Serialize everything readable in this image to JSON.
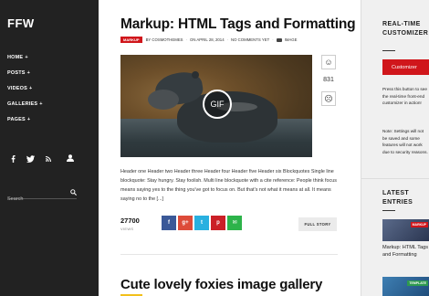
{
  "sidebar": {
    "logo": "FFW",
    "nav": [
      {
        "label": "HOME",
        "plus": "+"
      },
      {
        "label": "POSTS",
        "plus": "+"
      },
      {
        "label": "VIDEOS",
        "plus": "+"
      },
      {
        "label": "GALLERIES",
        "plus": "+"
      },
      {
        "label": "PAGES",
        "plus": "+"
      }
    ],
    "social_icons": [
      "facebook-icon",
      "twitter-icon",
      "rss-icon",
      "user-icon"
    ],
    "search": {
      "placeholder": "Search"
    }
  },
  "post": {
    "title": "Markup: HTML Tags and Formatting",
    "category": "MARKUP",
    "author": "BY COSMOTHEMES",
    "date": "ON APRIL 28, 2014",
    "comments": "NO COMMENTS YET",
    "format": "IMAGE",
    "image_badge": "GIF",
    "vote_count": "831",
    "excerpt": "Header one Header two Header three Header four Header five Header six Blockquotes Single line blockquote: Stay hungry. Stay foolish. Multi line blockquote with a cite reference: People think focus means saying yes to the thing you've got to focus on. But that's not what it means at all. It means saying no to the [...]",
    "views_count": "27700",
    "views_label": "VIEWS",
    "share": {
      "fb": "f",
      "gp": "g+",
      "tw": "t",
      "pi": "p",
      "em": "✉"
    },
    "full_story": "FULL STORY"
  },
  "post2": {
    "title": "Cute lovely foxies image gallery"
  },
  "customizer": {
    "title_line1": "REAL-TIME",
    "title_line2": "CUSTOMIZER",
    "button": "Customizer",
    "text": "Press this button to see the real-time front-end customizer in action!",
    "note": "Note: Settings will not be saved and some features will not work due to security reasons."
  },
  "latest": {
    "title_line1": "LATEST",
    "title_line2": "ENTRIES",
    "item1_badge": "MARKUP",
    "item1_title": "Markup: HTML Tags and Formatting",
    "item2_badge": "TEMPLATE"
  },
  "colors": {
    "accent_red": "#d0161b",
    "sidebar_bg": "#222222",
    "underline_yellow": "#f2c01c"
  }
}
